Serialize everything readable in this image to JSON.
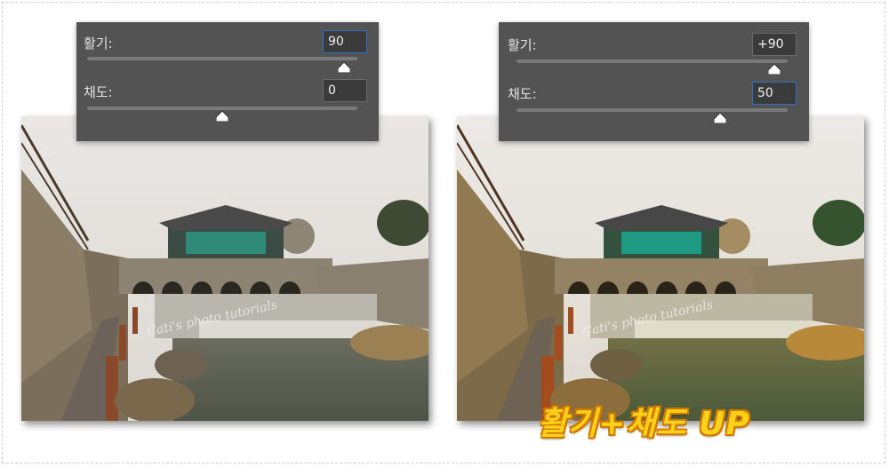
{
  "left_panel": {
    "vibrance_label": "활기:",
    "vibrance_value": "90",
    "vibrance_level": 0.95,
    "saturation_label": "채도:",
    "saturation_value": "0",
    "saturation_level": 0.5
  },
  "right_panel": {
    "vibrance_label": "활기:",
    "vibrance_value": "+90",
    "vibrance_level": 0.95,
    "saturation_label": "채도:",
    "saturation_value": "50",
    "saturation_level": 0.75
  },
  "watermark": "Cati's photo tutorials",
  "caption": "활기+채도 UP",
  "colors": {
    "panel_bg": "#535353",
    "input_bg": "#3b3b3b",
    "focus_border": "#2d6fc9",
    "caption_fill": "#ffd21a",
    "caption_outline": "#d27a00"
  }
}
